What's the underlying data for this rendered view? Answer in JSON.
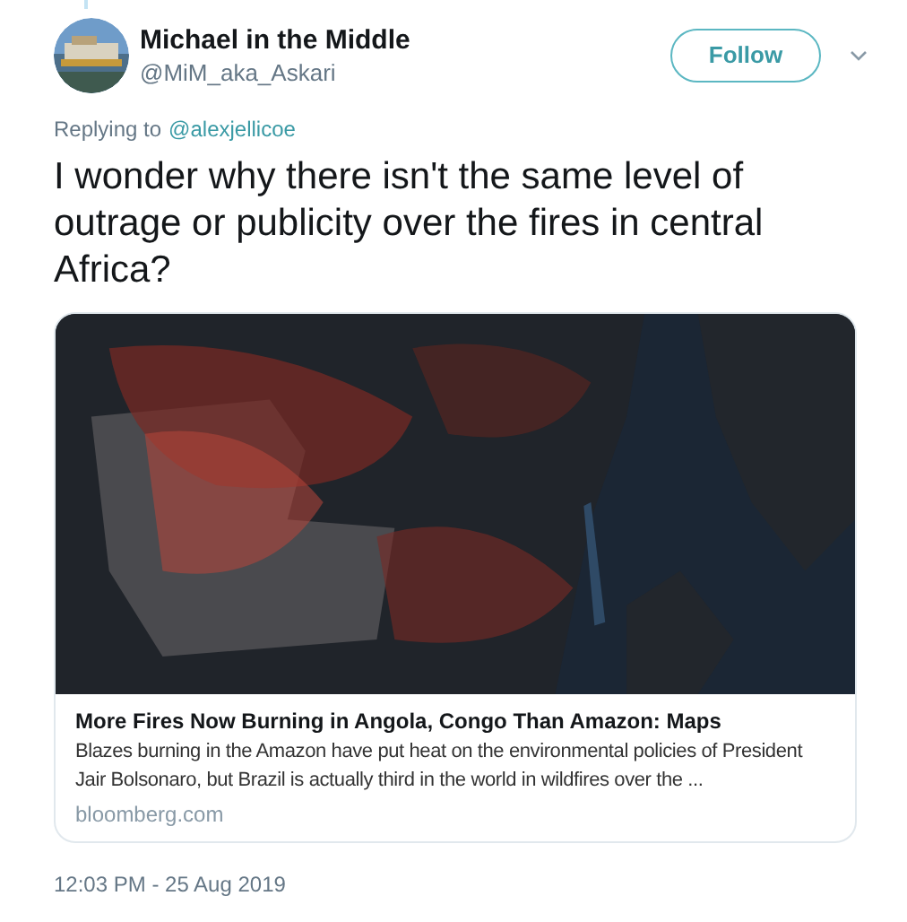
{
  "author": {
    "name": "Michael in the Middle",
    "handle": "@MiM_aka_Askari"
  },
  "follow_button": {
    "label": "Follow"
  },
  "reply_context": {
    "prefix": "Replying to",
    "mention": "@alexjellicoe"
  },
  "tweet_text": "I wonder why there isn't the same level of outrage or publicity over the fires in central Africa?",
  "card": {
    "title": "More Fires Now Burning in Angola, Congo Than Amazon: Maps",
    "description": "Blazes burning in the Amazon have put heat on the environmental policies of President Jair Bolsonaro, but Brazil is actually third in the world in wildfires over the ...",
    "domain": "bloomberg.com"
  },
  "timestamp": "12:03 PM - 25 Aug 2019"
}
